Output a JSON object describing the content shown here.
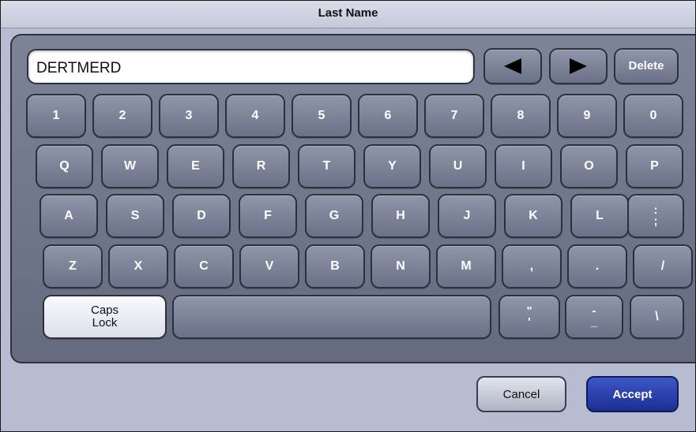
{
  "dialog": {
    "title": "Last Name"
  },
  "input": {
    "value": "DERTMERD"
  },
  "controls": {
    "left_icon": "left-arrow-icon",
    "right_icon": "right-arrow-icon",
    "delete": "Delete"
  },
  "rows": {
    "numbers": [
      "1",
      "2",
      "3",
      "4",
      "5",
      "6",
      "7",
      "8",
      "9",
      "0"
    ],
    "qwerty": [
      "Q",
      "W",
      "E",
      "R",
      "T",
      "Y",
      "U",
      "I",
      "O",
      "P"
    ],
    "asdf": [
      "A",
      "S",
      "D",
      "F",
      "G",
      "H",
      "J",
      "K",
      "L"
    ],
    "semicolon": {
      "top": ":",
      "bottom": ";"
    },
    "zxcv": [
      "Z",
      "X",
      "C",
      "V",
      "B",
      "N",
      "M",
      ",",
      ".",
      "/"
    ],
    "quote": {
      "top": "\"",
      "bottom": "'"
    },
    "dash": {
      "top": "-",
      "bottom": "_"
    },
    "backslash": "\\"
  },
  "caps": {
    "line1": "Caps",
    "line2": "Lock"
  },
  "buttons": {
    "cancel": "Cancel",
    "accept": "Accept"
  }
}
